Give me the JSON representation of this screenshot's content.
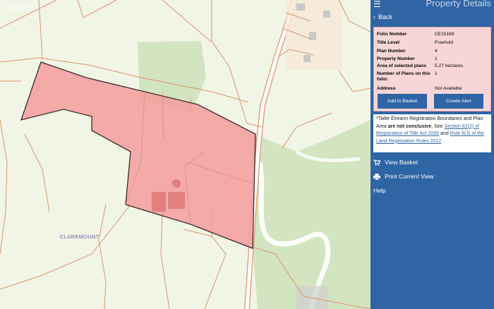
{
  "map": {
    "watermark": "roperty.ie",
    "place_label": "CLAREMOUNT",
    "colors": {
      "background": "#f1f5e6",
      "field_lines": "#d9936a",
      "selected_fill": "#f39c9c",
      "selected_stroke": "#3b2a2a",
      "forest": "#d3e4c0",
      "road": "#ffffff"
    }
  },
  "panel": {
    "menu_icon": "hamburger-menu-icon",
    "title": "Property Details",
    "back_label": "Back",
    "details": [
      {
        "key": "Folio Number",
        "value": "CE15169"
      },
      {
        "key": "Title Level",
        "value": "Freehold"
      },
      {
        "key": "Plan Number",
        "value": "4"
      },
      {
        "key": "Property Number",
        "value": "1"
      },
      {
        "key": "Area of selected plans",
        "value": "5.27 hectares."
      },
      {
        "key": "Number of Plans on this folio:",
        "value": "1"
      },
      {
        "key": "Address",
        "value": "Not Available"
      }
    ],
    "buttons": {
      "add_to_basket": "Add to Basket",
      "create_alert": "Create Alert"
    },
    "notice": {
      "prefix": "*Tailte Éireann Registration Boundaries and Plan Area",
      "bold": "are not conclusive",
      "mid": ". See",
      "link1": "Section 62(2) of Registration of Title Act 2006",
      "and": "and",
      "link2": "Rule 8(3) of the Land Registration Rules 2012"
    },
    "menu": [
      {
        "label": "View Basket",
        "icon": "cart-icon"
      },
      {
        "label": "Print Current View",
        "icon": "print-icon"
      },
      {
        "label": "Help",
        "icon": ""
      }
    ],
    "colors": {
      "background": "#2f64a5",
      "details_bg": "#f8d6d8",
      "button": "#2f64a5"
    }
  }
}
